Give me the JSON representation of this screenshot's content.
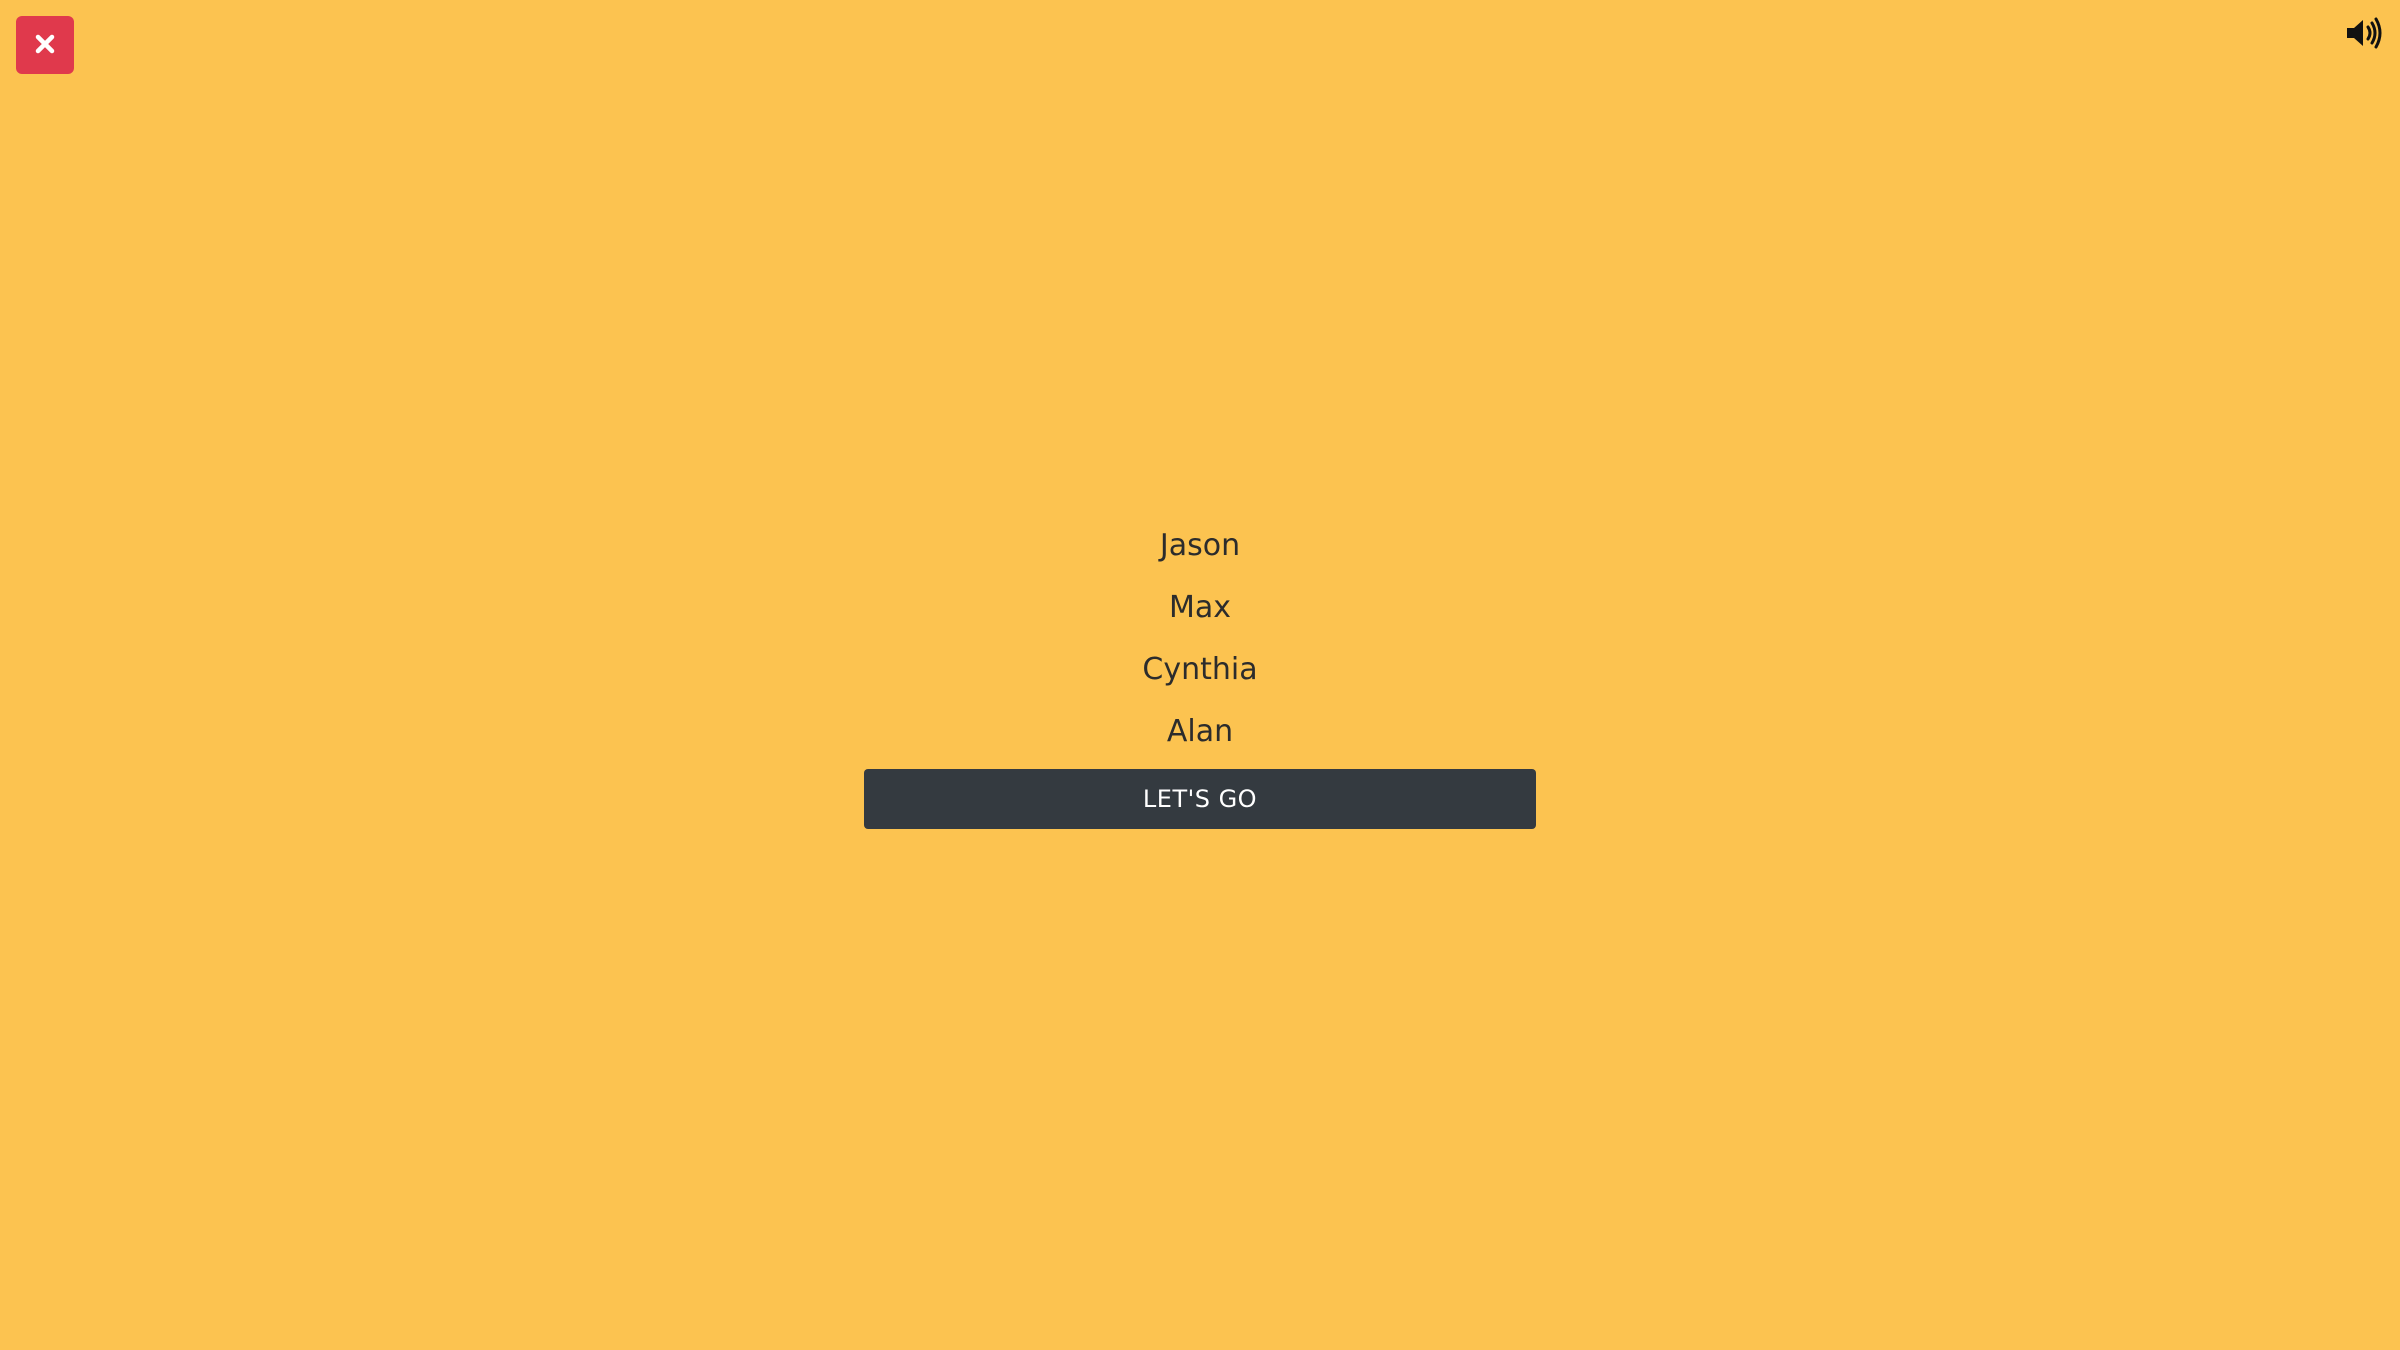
{
  "colors": {
    "background": "#fcc350",
    "close_button": "#e0394c",
    "primary_button": "#343a40",
    "text": "#2c2c2c"
  },
  "close_button": {
    "icon": "close-icon"
  },
  "sound_button": {
    "icon": "speaker-volume-icon"
  },
  "names": [
    "Jason",
    "Max",
    "Cynthia",
    "Alan"
  ],
  "go_button": {
    "label": "LET'S GO"
  }
}
